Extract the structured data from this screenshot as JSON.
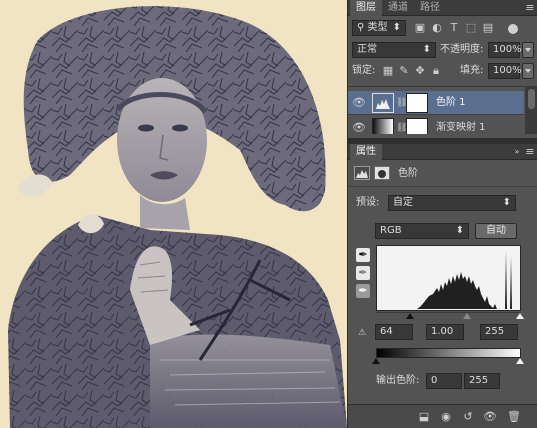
{
  "layers_panel": {
    "tabs": [
      {
        "label": "图层"
      },
      {
        "label": "通道"
      },
      {
        "label": "路径"
      }
    ],
    "filter": {
      "label": "类型"
    },
    "blend_mode": "正常",
    "opacity_label": "不透明度:",
    "opacity_value": "100%",
    "lock_label": "锁定:",
    "fill_label": "填充:",
    "fill_value": "100%",
    "layers": [
      {
        "name": "色阶 1",
        "selected": true
      },
      {
        "name": "渐变映射 1",
        "selected": false
      }
    ]
  },
  "properties_panel": {
    "title": "属性",
    "adjustment_name": "色阶",
    "preset_label": "预设:",
    "preset_value": "自定",
    "channel_value": "RGB",
    "auto_button": "自动",
    "input_black": "64",
    "input_gamma": "1.00",
    "input_white": "255",
    "output_label": "输出色阶:",
    "output_black": "0",
    "output_white": "255"
  },
  "colors": {
    "panel_bg": "#535353",
    "selected_layer": "#5a6f8f",
    "canvas_bg": "#f1e4c3",
    "ink": "#3e3e56"
  }
}
